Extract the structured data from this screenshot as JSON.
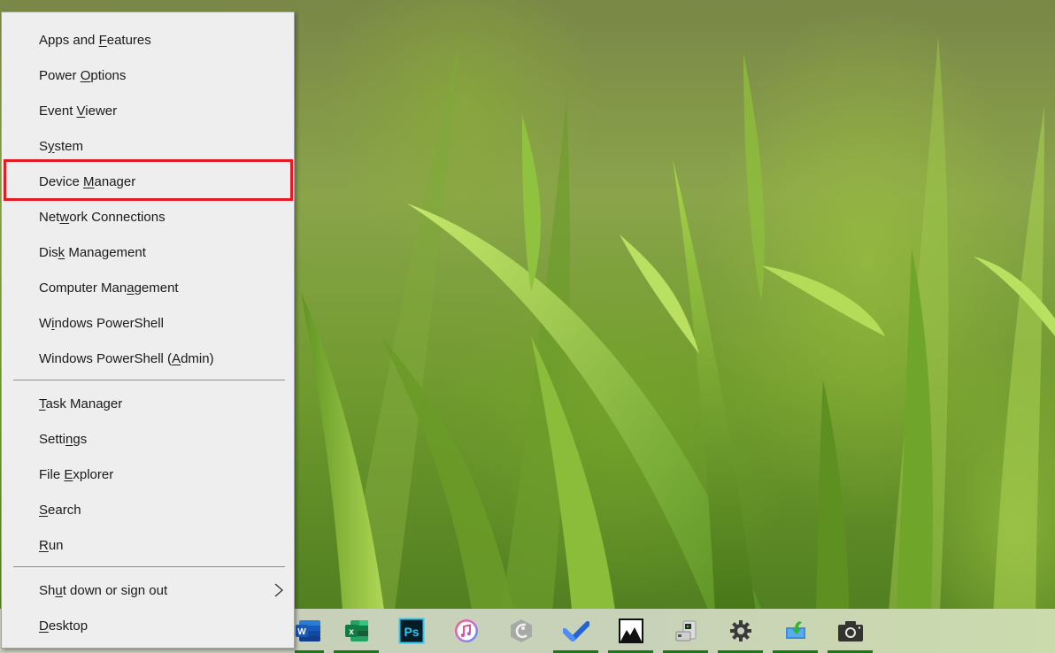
{
  "context_menu": {
    "groups": [
      {
        "items": [
          {
            "id": "apps-and-features",
            "label": "Apps and Features",
            "mnemonic_index": 9
          },
          {
            "id": "power-options",
            "label": "Power Options",
            "mnemonic_index": 6
          },
          {
            "id": "event-viewer",
            "label": "Event Viewer",
            "mnemonic_index": 6
          },
          {
            "id": "system",
            "label": "System",
            "mnemonic_index": 1
          },
          {
            "id": "device-manager",
            "label": "Device Manager",
            "mnemonic_index": 7,
            "highlighted": true
          },
          {
            "id": "network-connections",
            "label": "Network Connections",
            "mnemonic_index": 3
          },
          {
            "id": "disk-management",
            "label": "Disk Management",
            "mnemonic_index": 3
          },
          {
            "id": "computer-management",
            "label": "Computer Management",
            "mnemonic_index": 12
          },
          {
            "id": "windows-powershell",
            "label": "Windows PowerShell",
            "mnemonic_index": 1
          },
          {
            "id": "windows-powershell-admin",
            "label": "Windows PowerShell (Admin)",
            "mnemonic_index": 20
          }
        ]
      },
      {
        "items": [
          {
            "id": "task-manager",
            "label": "Task Manager",
            "mnemonic_index": 0
          },
          {
            "id": "settings",
            "label": "Settings",
            "mnemonic_index": 5
          },
          {
            "id": "file-explorer",
            "label": "File Explorer",
            "mnemonic_index": 5
          },
          {
            "id": "search",
            "label": "Search",
            "mnemonic_index": 0
          },
          {
            "id": "run",
            "label": "Run",
            "mnemonic_index": 0
          }
        ]
      },
      {
        "items": [
          {
            "id": "shut-down-or-sign-out",
            "label": "Shut down or sign out",
            "mnemonic_index": 2,
            "submenu": true
          },
          {
            "id": "desktop",
            "label": "Desktop",
            "mnemonic_index": 0
          }
        ]
      }
    ],
    "highlight_color": "#e21b24"
  },
  "taskbar": {
    "indicator_color": "#167a16",
    "apps": [
      {
        "name": "word",
        "icon": "word-icon",
        "running": true
      },
      {
        "name": "excel",
        "icon": "excel-icon",
        "running": true
      },
      {
        "name": "photoshop",
        "icon": "photoshop-icon",
        "running": false
      },
      {
        "name": "itunes",
        "icon": "itunes-icon",
        "running": false
      },
      {
        "name": "app-grey",
        "icon": "grey-hexagon-app-icon",
        "running": false
      },
      {
        "name": "microsoft-to-do",
        "icon": "checkmark-icon",
        "running": true
      },
      {
        "name": "photos",
        "icon": "photos-icon",
        "running": true
      },
      {
        "name": "scanner",
        "icon": "scanner-icon",
        "running": true
      },
      {
        "name": "settings",
        "icon": "gear-icon",
        "running": true
      },
      {
        "name": "snipping-download",
        "icon": "download-tray-icon",
        "running": true
      },
      {
        "name": "camera",
        "icon": "camera-icon",
        "running": true
      }
    ]
  }
}
